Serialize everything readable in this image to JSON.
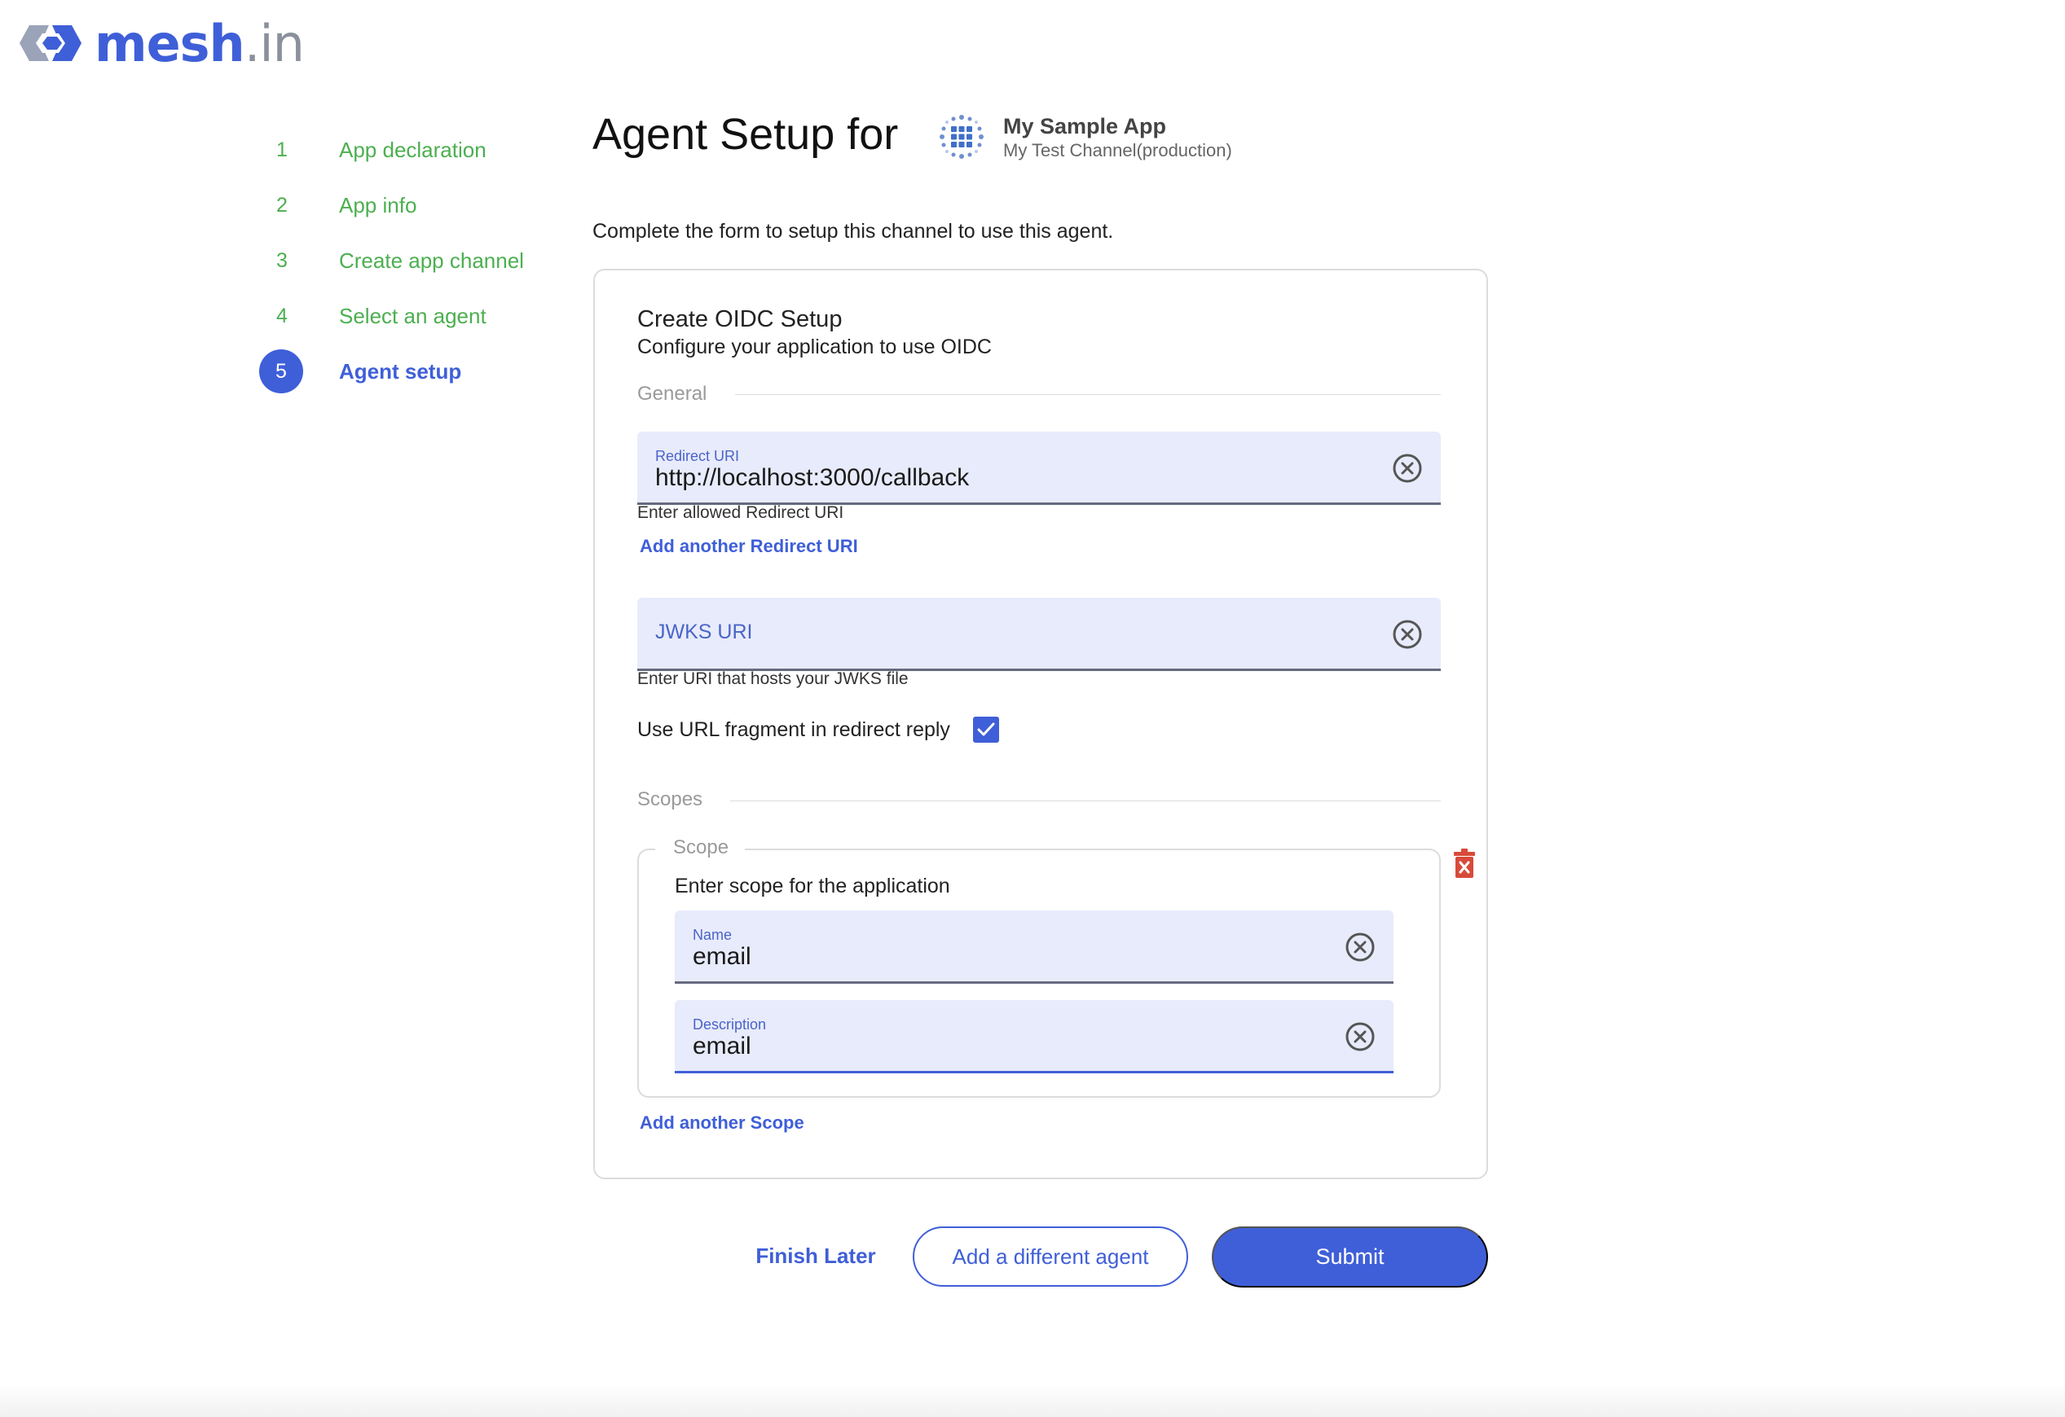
{
  "brand": {
    "logo_main": "mesh",
    "logo_suffix": ".in",
    "accent": "#3f5fd8",
    "success": "#4caf50"
  },
  "stepper": {
    "steps": [
      {
        "num": "1",
        "label": "App declaration",
        "state": "done"
      },
      {
        "num": "2",
        "label": "App info",
        "state": "done"
      },
      {
        "num": "3",
        "label": "Create app channel",
        "state": "done"
      },
      {
        "num": "4",
        "label": "Select an agent",
        "state": "done"
      },
      {
        "num": "5",
        "label": "Agent setup",
        "state": "active"
      }
    ]
  },
  "header": {
    "title": "Agent Setup for",
    "app_name": "My Sample App",
    "app_channel": "My Test Channel(production)",
    "app_icon": "grid-app-icon"
  },
  "intro": "Complete the form to setup this channel to use this agent.",
  "card": {
    "title": "Create OIDC Setup",
    "subtitle": "Configure your application to use OIDC",
    "general_label": "General",
    "redirect_uri": {
      "label": "Redirect URI",
      "value": "http://localhost:3000/callback",
      "helper": "Enter allowed Redirect URI",
      "add_link": "Add another Redirect URI"
    },
    "jwks_uri": {
      "placeholder": "JWKS URI",
      "helper": "Enter URI that hosts your JWKS file"
    },
    "url_fragment": {
      "label": "Use URL fragment in redirect reply",
      "checked": true
    },
    "scopes_label": "Scopes",
    "scope": {
      "legend": "Scope",
      "description": "Enter scope for the application",
      "name_label": "Name",
      "name_value": "email",
      "desc_label": "Description",
      "desc_value": "email"
    },
    "add_scope_link": "Add another Scope"
  },
  "actions": {
    "finish_later": "Finish Later",
    "add_different_agent": "Add a different agent",
    "submit": "Submit"
  }
}
